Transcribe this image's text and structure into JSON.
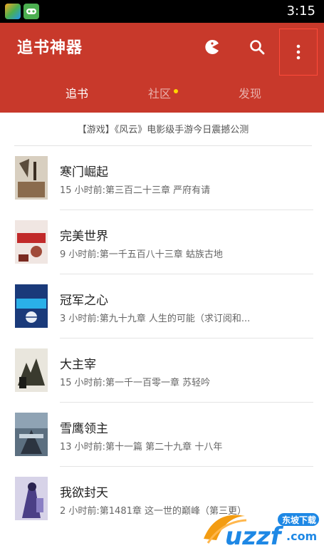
{
  "statusbar": {
    "time": "3:15"
  },
  "app": {
    "title": "追书神器"
  },
  "tabs": [
    {
      "label": "追书"
    },
    {
      "label": "社区"
    },
    {
      "label": "发现"
    }
  ],
  "notice": "【游戏】《风云》电影级手游今日震撼公测",
  "books": [
    {
      "title": "寒门崛起",
      "update": "15 小时前:第三百二十三章 严府有请",
      "cover_color": "#d8cfc0"
    },
    {
      "title": "完美世界",
      "update": "9 小时前:第一千五百八十三章 蛄族古地",
      "cover_color": "#f0e6e2"
    },
    {
      "title": "冠军之心",
      "update": "3 小时前:第九十九章 人生的可能（求订阅和...",
      "cover_color": "#1a3a7a"
    },
    {
      "title": "大主宰",
      "update": "15 小时前:第一千一百零一章 苏轻吟",
      "cover_color": "#e9e6dd"
    },
    {
      "title": "雪鹰领主",
      "update": "13 小时前:第十一篇 第二十九章 十八年",
      "cover_color": "#5c6f80"
    },
    {
      "title": "我欲封天",
      "update": "2 小时前:第1481章 这一世的巅峰（第三更）",
      "cover_color": "#d7d3e8"
    }
  ],
  "watermark": {
    "brand": "uzzf",
    "tag": "东坡下载",
    "domain": ".com"
  },
  "colors": {
    "primary": "#c8392b",
    "tab_dot": "#ffd500"
  }
}
